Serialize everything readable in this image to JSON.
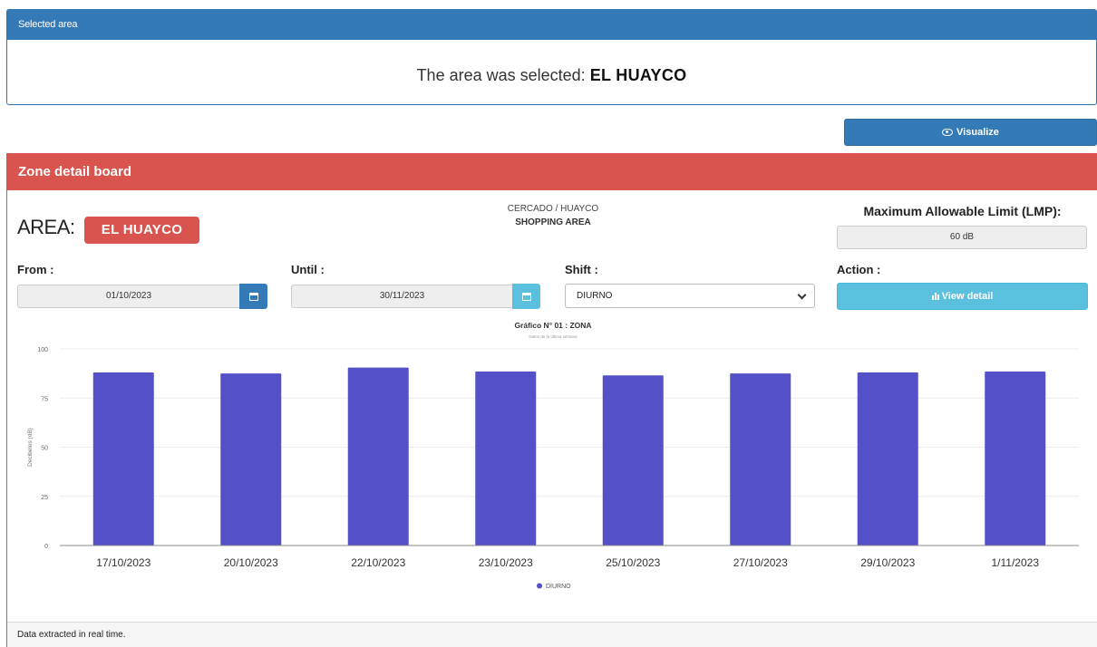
{
  "selected_panel": {
    "header": "Selected area",
    "message_prefix": "The area was selected:",
    "area_name": "EL HUAYCO"
  },
  "visualize_button": {
    "label": "Visualize",
    "icon": "eye-icon"
  },
  "zone_panel": {
    "header": "Zone detail board",
    "area_label": "AREA:",
    "area_badge": "EL HUAYCO",
    "location_line1": "CERCADO / HUAYCO",
    "location_line2": "SHOPPING AREA",
    "lmp_label": "Maximum Allowable Limit (LMP):",
    "lmp_value": "60 dB",
    "from_label": "From :",
    "from_value": "01/10/2023",
    "until_label": "Until :",
    "until_value": "30/11/2023",
    "shift_label": "Shift :",
    "shift_value": "DIURNO",
    "action_label": "Action :",
    "view_detail_label": "View detail",
    "footer": "Data extracted in real time."
  },
  "colors": {
    "primary": "#337ab7",
    "danger": "#d9534f",
    "info": "#5bc0de",
    "bar": "#5450c8"
  },
  "chart_data": {
    "type": "bar",
    "title": "Gráfico N° 01 : ZONA",
    "subtitle": "Datos de la última semana",
    "xlabel": "",
    "ylabel": "Decibeles (dB)",
    "ylim": [
      0,
      100
    ],
    "yticks": [
      0,
      25,
      50,
      75,
      100
    ],
    "grid": true,
    "legend_position": "bottom",
    "categories": [
      "17/10/2023",
      "20/10/2023",
      "22/10/2023",
      "23/10/2023",
      "25/10/2023",
      "27/10/2023",
      "29/10/2023",
      "1/11/2023"
    ],
    "series": [
      {
        "name": "DIURNO",
        "values": [
          88,
          87.5,
          90.5,
          88.5,
          86.5,
          87.5,
          88,
          88.5
        ]
      }
    ]
  }
}
